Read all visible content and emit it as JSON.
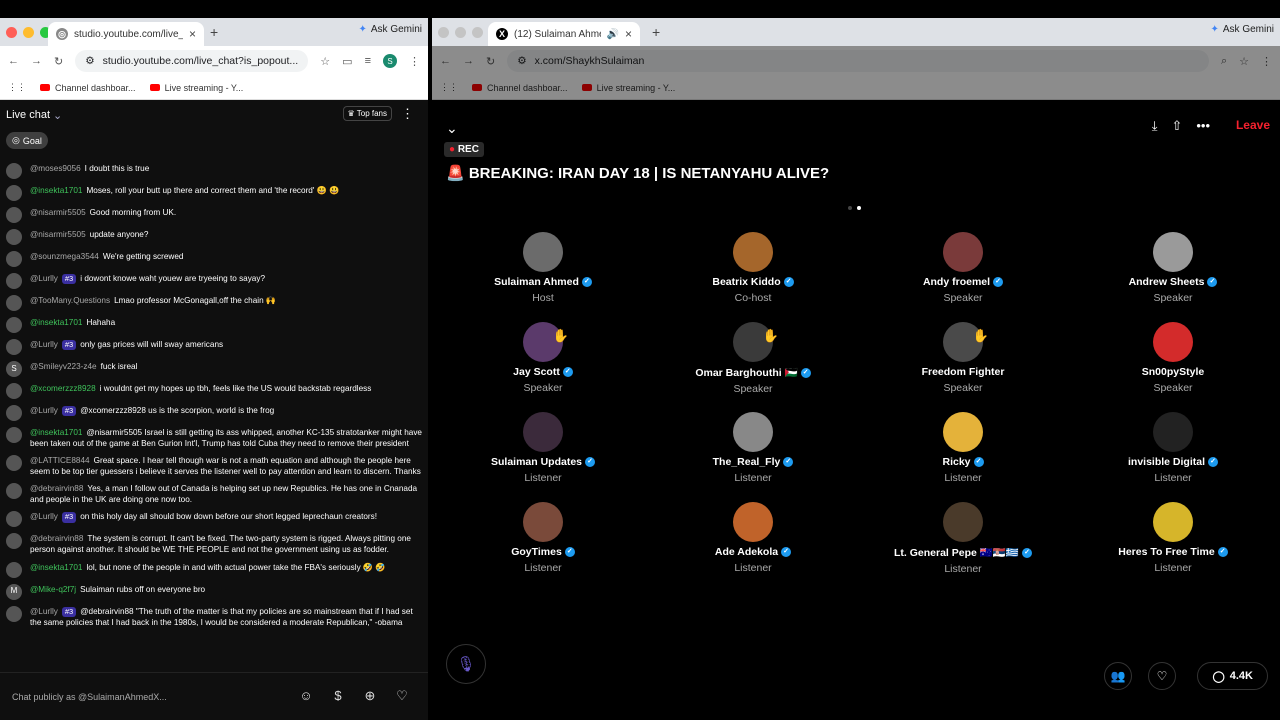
{
  "left_window": {
    "tab_title": "studio.youtube.com/live_chat",
    "url": "studio.youtube.com/live_chat?is_popout...",
    "ask_gemini": "Ask Gemini",
    "bookmarks": [
      "Channel dashboar...",
      "Live streaming - Y..."
    ],
    "profile": "S"
  },
  "chat": {
    "title": "Live chat",
    "top_fans": "Top fans",
    "goal": "Goal",
    "input_placeholder": "Chat publicly as @SulaimanAhmedX...",
    "messages": [
      {
        "author": "@moses9056",
        "text": "I doubt this is true",
        "av": "",
        "badge": "",
        "green": false
      },
      {
        "author": "@insekta1701",
        "text": "Moses, roll your butt up there and correct them and 'the record' 😃 😃",
        "av": "",
        "badge": "",
        "green": true
      },
      {
        "author": "@nisarmir5505",
        "text": "Good morning from UK.",
        "av": "",
        "badge": "",
        "green": false
      },
      {
        "author": "@nisarmir5505",
        "text": "update anyone?",
        "av": "",
        "badge": "",
        "green": false
      },
      {
        "author": "@sounzmega3544",
        "text": "We're getting screwed",
        "av": "",
        "badge": "",
        "green": false
      },
      {
        "author": "@Lurlly",
        "text": "i dowont knowe waht youew are tryeeing to sayay?",
        "av": "",
        "badge": "#3",
        "green": false
      },
      {
        "author": "@TooMany.Questions",
        "text": "Lmao professor McGonagall,off the chain 🙌",
        "av": "",
        "badge": "",
        "green": false
      },
      {
        "author": "@insekta1701",
        "text": "Hahaha",
        "av": "",
        "badge": "",
        "green": true
      },
      {
        "author": "@Lurlly",
        "text": "only gas prices will will sway americans",
        "av": "",
        "badge": "#3",
        "green": false
      },
      {
        "author": "@Smileyv223-z4e",
        "text": "fuck isreal",
        "av": "S",
        "badge": "",
        "green": false
      },
      {
        "author": "@xcomerzzz8928",
        "text": "i wouldnt get my hopes up tbh, feels like the US would backstab regardless",
        "av": "",
        "badge": "",
        "green": true
      },
      {
        "author": "@Lurlly",
        "text": "@xcomerzzz8928 us is the scorpion, world is the frog",
        "av": "",
        "badge": "#3",
        "green": false
      },
      {
        "author": "@insekta1701",
        "text": "@nisarmir5505 Israel is still getting its ass whipped, another KC-135 stratotanker might have been taken out of the game at Ben Gurion Int'l, Trump has told Cuba they need to remove their president",
        "av": "",
        "badge": "",
        "green": true
      },
      {
        "author": "@LATTICE8844",
        "text": "Great space. I hear tell though war is not a math equation and although the people here seem to be top tier guessers i believe it serves the listener well to pay attention and learn to discern. Thanks",
        "av": "",
        "badge": "",
        "green": false
      },
      {
        "author": "@debrairvin88",
        "text": "Yes, a man I follow out of Canada is helping set up new Republics. He has one in Cnanada and people in the UK are doing one now too.",
        "av": "",
        "badge": "",
        "green": false
      },
      {
        "author": "@Lurlly",
        "text": "on this holy day all should bow down before our short legged leprechaun creators!",
        "av": "",
        "badge": "#3",
        "green": false
      },
      {
        "author": "@debrairvin88",
        "text": "The system is corrupt. It can't be fixed. The two-party system is rigged. Always pitting one person against another. It should be WE THE PEOPLE and not the government using us as fodder.",
        "av": "",
        "badge": "",
        "green": false
      },
      {
        "author": "@insekta1701",
        "text": "lol, but none of the people in and with actual power take the FBA's seriously 🤣 🤣",
        "av": "",
        "badge": "",
        "green": true
      },
      {
        "author": "@Mike-q2f7j",
        "text": "Sulaiman rubs off on everyone bro",
        "av": "M",
        "badge": "",
        "green": true
      },
      {
        "author": "@Lurlly",
        "text": "@debrairvin88 \"The truth of the matter is that my policies are so mainstream that if I had set the same policies that I had back in the 1980s, I would be considered a moderate Republican,\" -obama",
        "av": "",
        "badge": "#3",
        "green": false
      }
    ]
  },
  "right_window": {
    "tab_title": "(12) Sulaiman Ahmed (@S...",
    "url": "x.com/ShaykhSulaiman",
    "ask_gemini": "Ask Gemini",
    "bookmarks": [
      "Channel dashboar...",
      "Live streaming - Y..."
    ]
  },
  "space": {
    "rec": "REC",
    "title": "🚨 BREAKING: IRAN DAY 18 | IS NETANYAHU ALIVE?",
    "leave": "Leave",
    "listener_count": "4.4K",
    "participants": [
      {
        "name": "Sulaiman Ahmed",
        "role": "Host",
        "verified": true,
        "hand": false
      },
      {
        "name": "Beatrix Kiddo",
        "role": "Co-host",
        "verified": true,
        "hand": false
      },
      {
        "name": "Andy froemel",
        "role": "Speaker",
        "verified": true,
        "hand": false
      },
      {
        "name": "Andrew Sheets",
        "role": "Speaker",
        "verified": true,
        "hand": false
      },
      {
        "name": "Jay Scott",
        "role": "Speaker",
        "verified": true,
        "hand": true
      },
      {
        "name": "Omar Barghouthi 🇵🇸",
        "role": "Speaker",
        "verified": true,
        "hand": true
      },
      {
        "name": "Freedom Fighter",
        "role": "Speaker",
        "verified": false,
        "hand": true
      },
      {
        "name": "Sn00pyStyle",
        "role": "Speaker",
        "verified": false,
        "hand": false
      },
      {
        "name": "Sulaiman Updates",
        "role": "Listener",
        "verified": true,
        "hand": false
      },
      {
        "name": "The_Real_Fly",
        "role": "Listener",
        "verified": true,
        "hand": false
      },
      {
        "name": "Ricky",
        "role": "Listener",
        "verified": true,
        "hand": false
      },
      {
        "name": "invisible Digital",
        "role": "Listener",
        "verified": true,
        "hand": false
      },
      {
        "name": "GoyTimes",
        "role": "Listener",
        "verified": true,
        "hand": false
      },
      {
        "name": "Ade Adekola",
        "role": "Listener",
        "verified": true,
        "hand": false
      },
      {
        "name": "Lt. General Pepe 🇦🇺🇷🇸🇬🇷",
        "role": "Listener",
        "verified": true,
        "hand": false
      },
      {
        "name": "Heres To Free Time",
        "role": "Listener",
        "verified": true,
        "hand": false
      }
    ]
  }
}
